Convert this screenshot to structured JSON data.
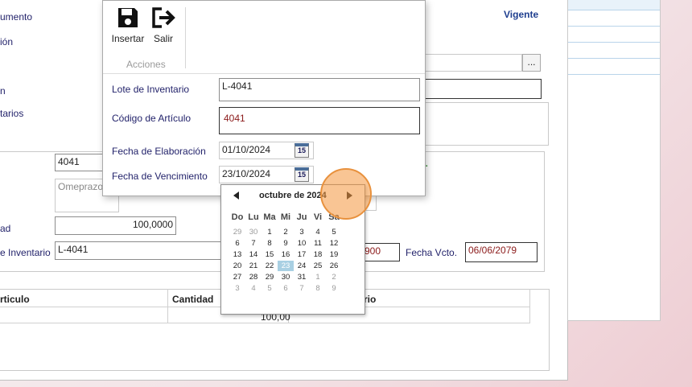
{
  "form": {
    "labels": {
      "documento": "umento",
      "descripcion": "ión",
      "seven": "n",
      "comentarios": "tarios",
      "codigo": "",
      "cantidad": "ad",
      "lote": "e Inventario"
    },
    "status": "Vigente",
    "browse_button": "...",
    "codigo_value": "4041",
    "descripcion_value": "Omeprazo",
    "cantidad_value": "100,0000",
    "lote_value": "L-4041",
    "fecha_elab_partial": "900",
    "fecha_vcto_label": "Fecha Vcto.",
    "fecha_vcto_value": "06/06/2079",
    "green_text": "o.",
    "table": {
      "headers": [
        "rticulo",
        "Cantidad",
        "rio"
      ],
      "row_cantidad": "100,00"
    }
  },
  "dialog": {
    "toolbar": {
      "insert_label": "Insertar",
      "exit_label": "Salir",
      "group_label": "Acciones"
    },
    "fields": {
      "lote_label": "Lote de Inventario",
      "lote_value": "L-4041",
      "codigo_label": "Código de Artículo",
      "codigo_value": "4041",
      "fecha_elab_label": "Fecha de Elaboración",
      "fecha_elab_value": "01/10/2024",
      "fecha_venc_label": "Fecha de Vencimiento",
      "fecha_venc_value": "23/10/2024",
      "calendar_icon_text": "15"
    }
  },
  "calendar": {
    "month_label": "octubre de 2024",
    "weekdays": [
      "Do",
      "Lu",
      "Ma",
      "Mi",
      "Ju",
      "Vi",
      "Sa"
    ],
    "weeks": [
      [
        "29",
        "30",
        "1",
        "2",
        "3",
        "4",
        "5"
      ],
      [
        "6",
        "7",
        "8",
        "9",
        "10",
        "11",
        "12"
      ],
      [
        "13",
        "14",
        "15",
        "16",
        "17",
        "18",
        "19"
      ],
      [
        "20",
        "21",
        "22",
        "23",
        "24",
        "25",
        "26"
      ],
      [
        "27",
        "28",
        "29",
        "30",
        "31",
        "1",
        "2"
      ],
      [
        "3",
        "4",
        "5",
        "6",
        "7",
        "8",
        "9"
      ]
    ],
    "selected": "23"
  },
  "colors": {
    "accent": "#a9d0e3",
    "click_marker": "#f4963c",
    "label_text": "#23236b",
    "red_value": "#8b1a1a"
  }
}
